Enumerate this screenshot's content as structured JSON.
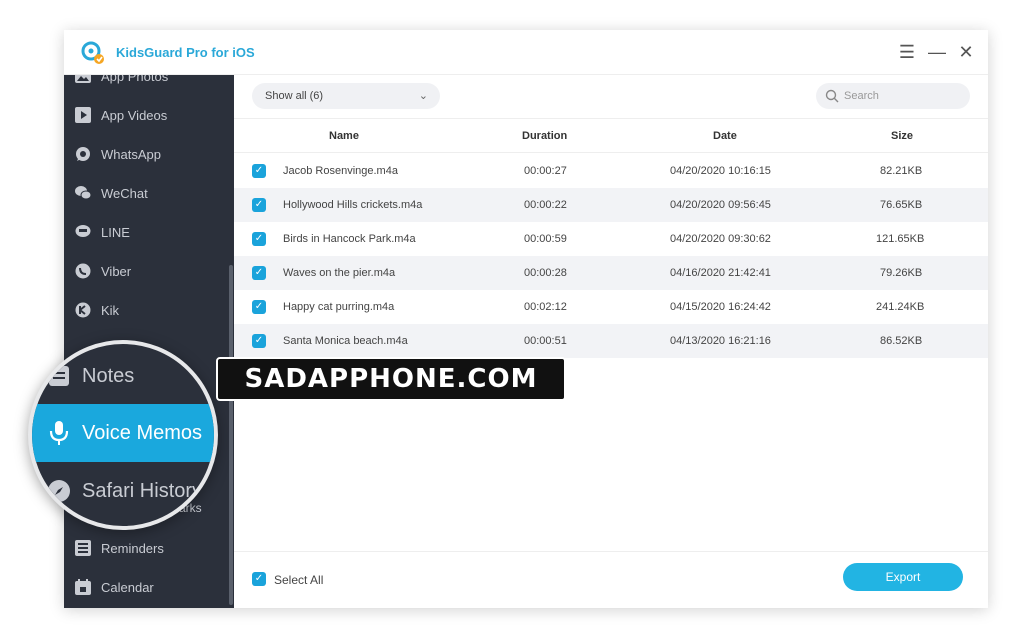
{
  "app": {
    "title": "KidsGuard Pro for iOS"
  },
  "window_controls": {
    "menu": "☰",
    "minimize": "—",
    "close": "✕"
  },
  "sidebar": {
    "items": [
      {
        "label": "App Photos",
        "icon": "photo-icon"
      },
      {
        "label": "App Videos",
        "icon": "video-icon"
      },
      {
        "label": "WhatsApp",
        "icon": "whatsapp-icon"
      },
      {
        "label": "WeChat",
        "icon": "wechat-icon"
      },
      {
        "label": "LINE",
        "icon": "line-icon"
      },
      {
        "label": "Viber",
        "icon": "viber-icon"
      },
      {
        "label": "Kik",
        "icon": "kik-icon"
      },
      {
        "label": "Reminders",
        "icon": "reminders-icon"
      },
      {
        "label": "Calendar",
        "icon": "calendar-icon"
      }
    ],
    "partial_label": "arks"
  },
  "magnifier": {
    "items": [
      {
        "label": "Notes",
        "icon": "notes-icon",
        "active": false
      },
      {
        "label": "Voice Memos",
        "icon": "microphone-icon",
        "active": true
      },
      {
        "label": "Safari History",
        "icon": "compass-icon",
        "active": false
      }
    ]
  },
  "toolbar": {
    "filter_label": "Show all (6)",
    "search_placeholder": "Search"
  },
  "table": {
    "columns": [
      "Name",
      "Duration",
      "Date",
      "Size"
    ],
    "rows": [
      {
        "name": "Jacob Rosenvinge.m4a",
        "duration": "00:00:27",
        "date": "04/20/2020 10:16:15",
        "size": "82.21KB",
        "checked": true
      },
      {
        "name": "Hollywood Hills crickets.m4a",
        "duration": "00:00:22",
        "date": "04/20/2020 09:56:45",
        "size": "76.65KB",
        "checked": true
      },
      {
        "name": "Birds in Hancock Park.m4a",
        "duration": "00:00:59",
        "date": "04/20/2020 09:30:62",
        "size": "121.65KB",
        "checked": true
      },
      {
        "name": "Waves on the pier.m4a",
        "duration": "00:00:28",
        "date": "04/16/2020 21:42:41",
        "size": "79.26KB",
        "checked": true
      },
      {
        "name": "Happy cat purring.m4a",
        "duration": "00:02:12",
        "date": "04/15/2020 16:24:42",
        "size": "241.24KB",
        "checked": true
      },
      {
        "name": "Santa Monica beach.m4a",
        "duration": "00:00:51",
        "date": "04/13/2020 16:21:16",
        "size": "86.52KB",
        "checked": true
      }
    ]
  },
  "footer": {
    "select_all_label": "Select All",
    "export_label": "Export"
  },
  "watermark": {
    "text": "SADAPPHONE.COM"
  },
  "colors": {
    "accent": "#1aa8dd",
    "sidebar_bg": "#2b303b",
    "title": "#2aa8d8"
  }
}
